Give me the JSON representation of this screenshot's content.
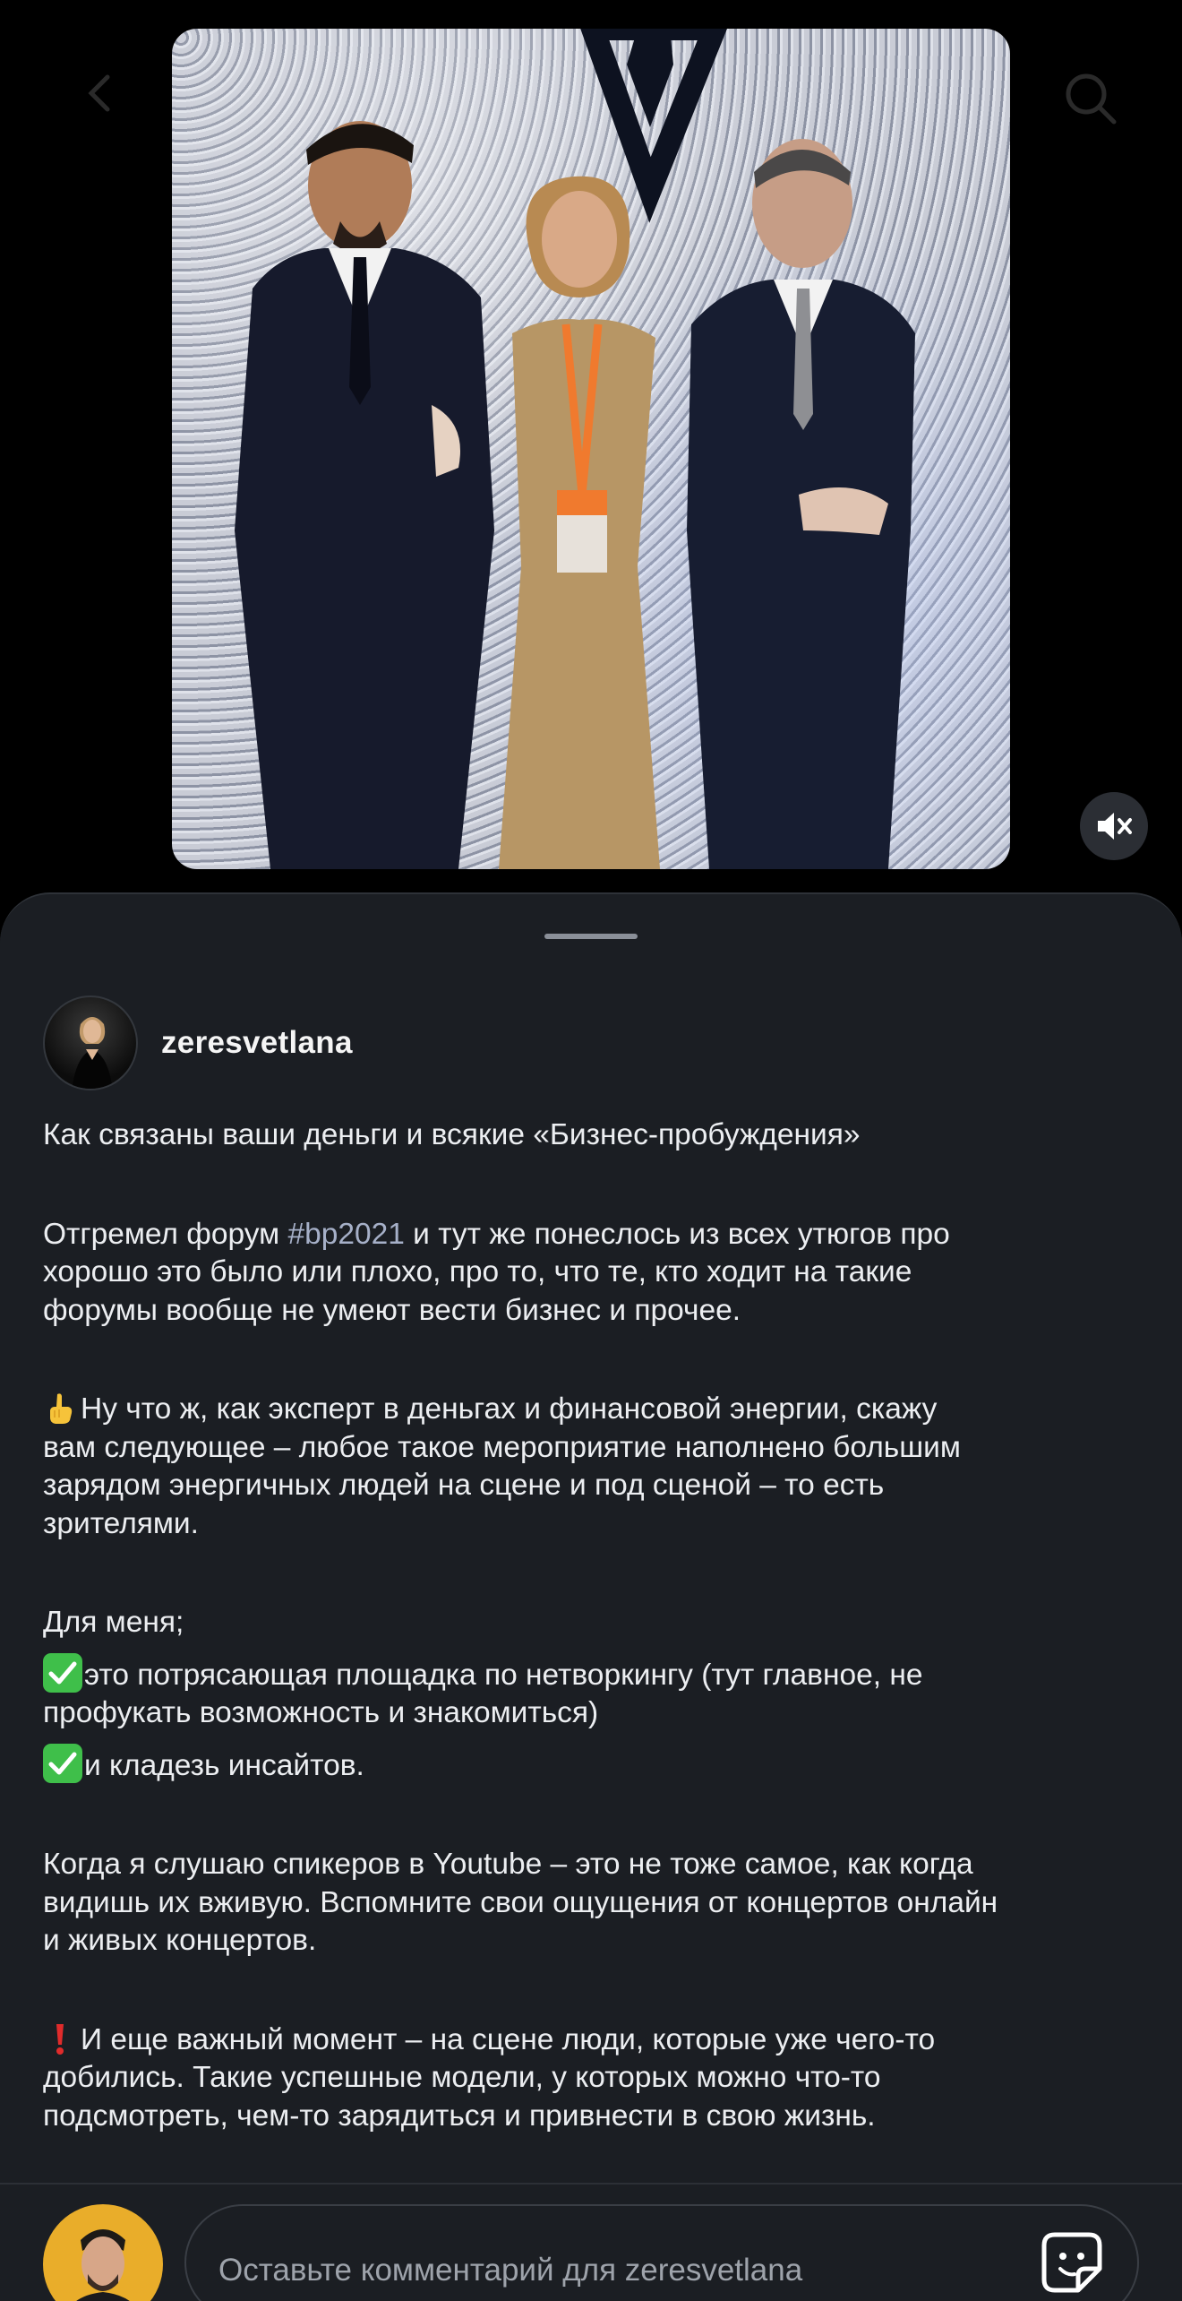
{
  "post": {
    "author": "zeresvetlana",
    "caption": {
      "title": "Как связаны ваши деньги и всякие «Бизнес-пробуждения»",
      "p1_lines": [
        [
          "Отгремел форум ",
          "#bp2021",
          " и тут же понеслось из всех утюгов про"
        ],
        "хорошо это было или плохо, про то, что те, кто ходит на такие",
        "форумы вообще не умеют вести бизнес и прочее."
      ],
      "p2_lines": [
        "Ну что ж, как эксперт в деньгах и финансовой энергии, скажу",
        "вам следующее – любое такое мероприятие наполнено большим",
        "зарядом энергичных людей на сцене и под сценой – то есть",
        "зрителями."
      ],
      "p3_intro": "Для меня;",
      "p3_item1_lines": [
        "это потрясающая площадка по нетворкингу (тут главное, не",
        "профукать возможность и знакомиться)"
      ],
      "p3_item2": "и кладезь инсайтов.",
      "p4_lines": [
        "Когда я слушаю спикеров в Youtube – это не тоже самое, как когда",
        "видишь их вживую. Вспомните свои ощущения от концертов онлайн",
        "и живых концертов."
      ],
      "p5_lines": [
        "И еще важный момент – на сцене люди, которые уже чего-то",
        "добились. Такие успешные модели, у которых можно что-то",
        "подсмотреть, чем-то зарядиться и привнести в свою жизнь."
      ]
    }
  },
  "comment_bar": {
    "placeholder": "Оставьте комментарий для zeresvetlana"
  },
  "icons": {
    "back": "chevron-left-icon",
    "search": "search-icon",
    "mute": "speaker-muted-icon",
    "sticker": "sticker-icon",
    "point_up": "point-up-emoji",
    "check": "check-mark-emoji",
    "exclamation": "red-exclamation-emoji"
  },
  "colors": {
    "sheet_bg": "#1b1e23",
    "hashtag": "#a6b0c8",
    "check_green": "#3fbf4a"
  }
}
